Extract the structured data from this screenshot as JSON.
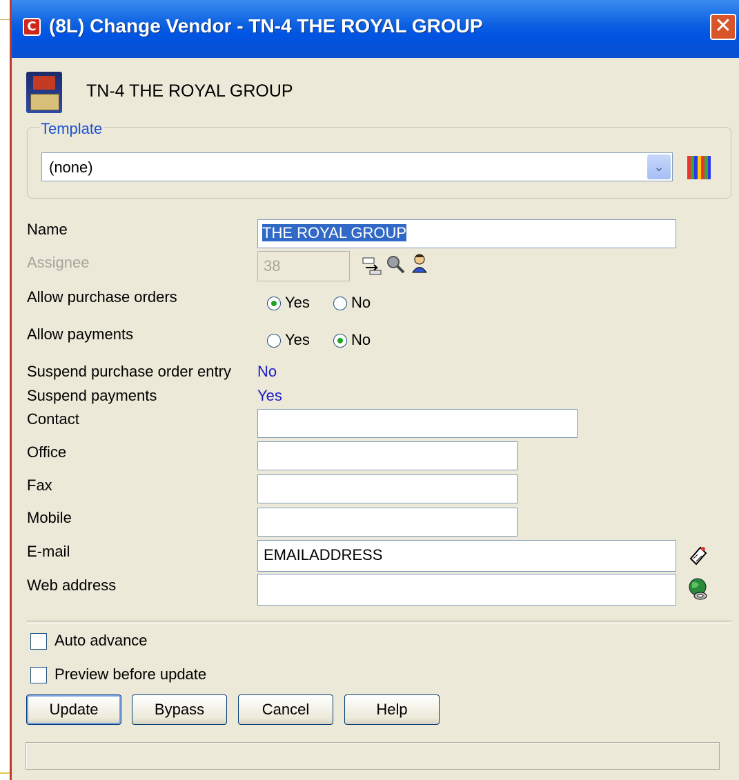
{
  "window": {
    "title": "(8L) Change Vendor - TN-4   THE ROYAL GROUP",
    "app_icon": "C",
    "close_symbol": "✕"
  },
  "vendor_heading": "TN-4   THE ROYAL GROUP",
  "template": {
    "legend": "Template",
    "selected": "(none)",
    "arrow": "⌄"
  },
  "fields": {
    "name_label": "Name",
    "name_value": "THE ROYAL GROUP",
    "assignee_label": "Assignee",
    "assignee_value": "38",
    "allow_po_label": "Allow purchase orders",
    "allow_po_yes": "Yes",
    "allow_po_no": "No",
    "allow_po_selected": "Yes",
    "allow_pay_label": "Allow payments",
    "allow_pay_yes": "Yes",
    "allow_pay_no": "No",
    "allow_pay_selected": "No",
    "suspend_po_label": "Suspend purchase order entry",
    "suspend_po_value": "No",
    "suspend_pay_label": "Suspend payments",
    "suspend_pay_value": "Yes",
    "contact_label": "Contact",
    "contact_value": "",
    "office_label": "Office",
    "office_value": "",
    "fax_label": "Fax",
    "fax_value": "",
    "mobile_label": "Mobile",
    "mobile_value": "",
    "email_label": "E-mail",
    "email_value": "EMAILADDRESS",
    "web_label": "Web address",
    "web_value": ""
  },
  "options": {
    "auto_advance": "Auto advance",
    "auto_advance_checked": false,
    "preview": "Preview before update",
    "preview_checked": false
  },
  "buttons": {
    "update": "Update",
    "bypass": "Bypass",
    "cancel": "Cancel",
    "help": "Help"
  },
  "status_text": "",
  "icons": [
    "vendor-logo-icon",
    "template-grid-icon",
    "assign-arrow-icon",
    "search-icon",
    "person-icon",
    "email-icon",
    "globe-icon"
  ],
  "colors": {
    "titlebar": "#0054e3",
    "accent_blue": "#1a52d4",
    "value_blue": "#1a1ac8",
    "selection": "#3169c6",
    "dialog_bg": "#ece9d8"
  }
}
